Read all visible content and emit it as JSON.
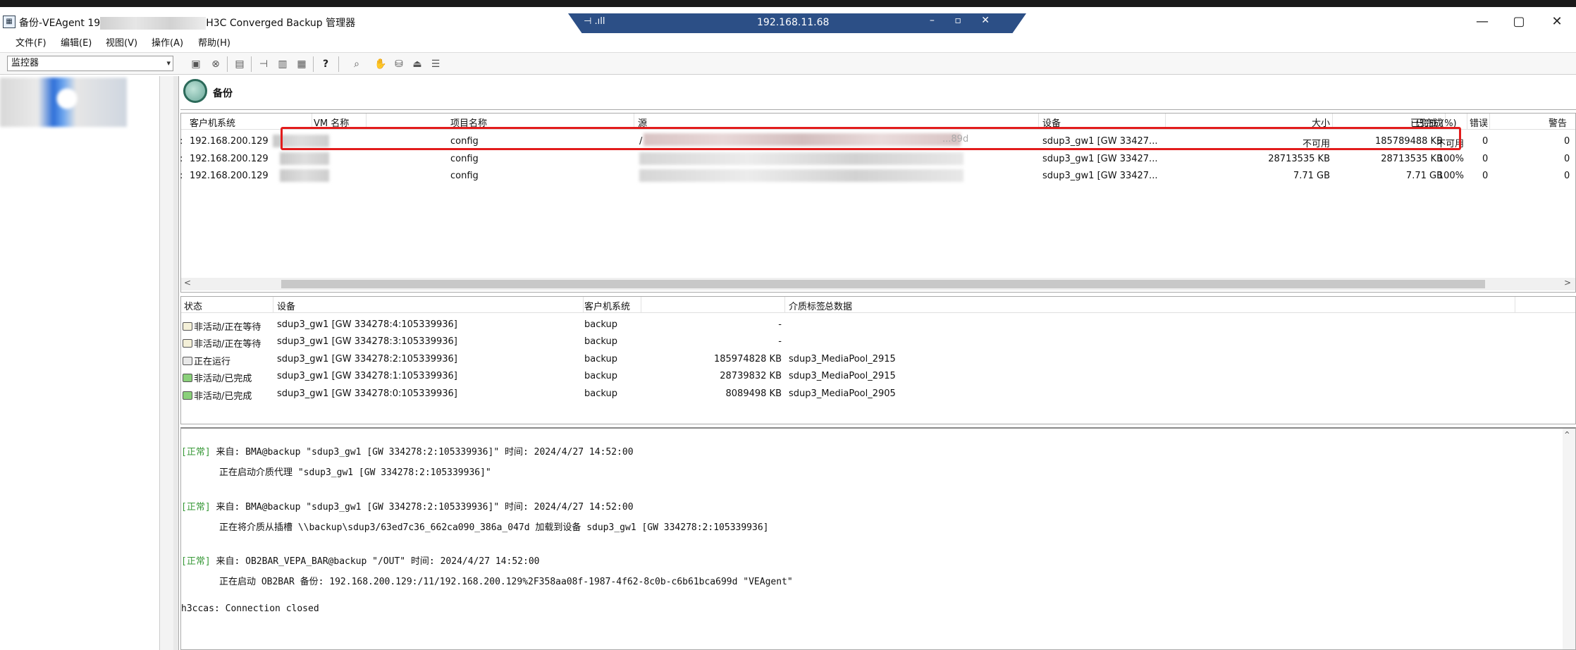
{
  "window": {
    "title_prefix": "备份-VEAgent 19",
    "title_suffix": "H3C Converged Backup 管理器",
    "min_glyph": "—",
    "max_glyph": "▢",
    "close_glyph": "✕"
  },
  "rdp": {
    "left_text": "⊣ .ıll",
    "host": "192.168.11.68",
    "controls": "– ▫ ✕"
  },
  "menu": [
    "文件(F)",
    "编辑(E)",
    "视图(V)",
    "操作(A)",
    "帮助(H)"
  ],
  "toolbar": {
    "context_value": "监控器",
    "buttons": [
      "save-icon",
      "stop-icon",
      "report-icon",
      "pin-icon",
      "list-icon",
      "calendar-icon",
      "help-icon",
      "zoom-icon",
      "hand-icon",
      "disk-icon",
      "eject-icon",
      "tape-icon"
    ],
    "help_glyph": "?"
  },
  "header": {
    "title": "备份"
  },
  "sessions": {
    "columns": [
      "客户机系统",
      "VM 名称",
      "项目名称",
      "源",
      "设备",
      "大小",
      "已完成",
      "已完成 (%)",
      "错误",
      "警告"
    ],
    "rows": [
      {
        "client": "192.168.200.129",
        "project": "config",
        "device": "sdup3_gw1 [GW 33427...",
        "size": "不可用",
        "done": "185789488  KB",
        "pct": "不可用",
        "errors": "0",
        "warnings": "0"
      },
      {
        "client": "192.168.200.129",
        "project": "config",
        "device": "sdup3_gw1 [GW 33427...",
        "size": "28713535  KB",
        "done": "28713535  KB",
        "pct": "100%",
        "errors": "0",
        "warnings": "0"
      },
      {
        "client": "192.168.200.129",
        "project": "config",
        "device": "sdup3_gw1 [GW 33427...",
        "size": "7.71  GB",
        "done": "7.71  GB",
        "pct": "100%",
        "errors": "0",
        "warnings": "0"
      }
    ],
    "row_prefix": ":",
    "src_frag_1": "/",
    "src_frag_2": "...89d"
  },
  "devices": {
    "columns": [
      "状态",
      "设备",
      "客户机系统",
      "总数据",
      "介质标签"
    ],
    "rows": [
      {
        "status": "非活动/正在等待",
        "icon": "waiting-icon",
        "device": "sdup3_gw1 [GW 334278:4:105339936]",
        "client": "backup",
        "total": "-",
        "label": ""
      },
      {
        "status": "非活动/正在等待",
        "icon": "waiting-icon",
        "device": "sdup3_gw1 [GW 334278:3:105339936]",
        "client": "backup",
        "total": "-",
        "label": ""
      },
      {
        "status": "正在运行",
        "icon": "running-icon",
        "device": "sdup3_gw1 [GW 334278:2:105339936]",
        "client": "backup",
        "total": "185974828  KB",
        "label": "sdup3_MediaPool_2915"
      },
      {
        "status": "非活动/已完成",
        "icon": "completed-icon",
        "device": "sdup3_gw1 [GW 334278:1:105339936]",
        "client": "backup",
        "total": "28739832  KB",
        "label": "sdup3_MediaPool_2915"
      },
      {
        "status": "非活动/已完成",
        "icon": "completed-icon",
        "device": "sdup3_gw1 [GW 334278:0:105339936]",
        "client": "backup",
        "total": "8089498  KB",
        "label": "sdup3_MediaPool_2905"
      }
    ]
  },
  "log": [
    {
      "tag": "[正常]",
      "header": " 来自: BMA@backup \"sdup3_gw1 [GW 334278:2:105339936]\"  时间:  2024/4/27 14:52:00",
      "body": "正在启动介质代理 \"sdup3_gw1 [GW 334278:2:105339936]\""
    },
    {
      "tag": "[正常]",
      "header": " 来自: BMA@backup \"sdup3_gw1 [GW 334278:2:105339936]\"  时间:  2024/4/27 14:52:00",
      "body": "正在将介质从插槽 \\\\backup\\sdup3/63ed7c36_662ca090_386a_047d 加载到设备 sdup3_gw1 [GW 334278:2:105339936]"
    },
    {
      "tag": "[正常]",
      "header": " 来自: OB2BAR_VEPA_BAR@backup \"/OUT\"  时间:  2024/4/27 14:52:00",
      "body": "正在启动 OB2BAR 备份: 192.168.200.129:/11/192.168.200.129%2F358aa08f-1987-4f62-8c0b-c6b61bca699d \"VEAgent\""
    }
  ],
  "log_footer": "h3ccas: Connection closed",
  "scroll": {
    "left": "<",
    "right": ">",
    "up": "^"
  }
}
